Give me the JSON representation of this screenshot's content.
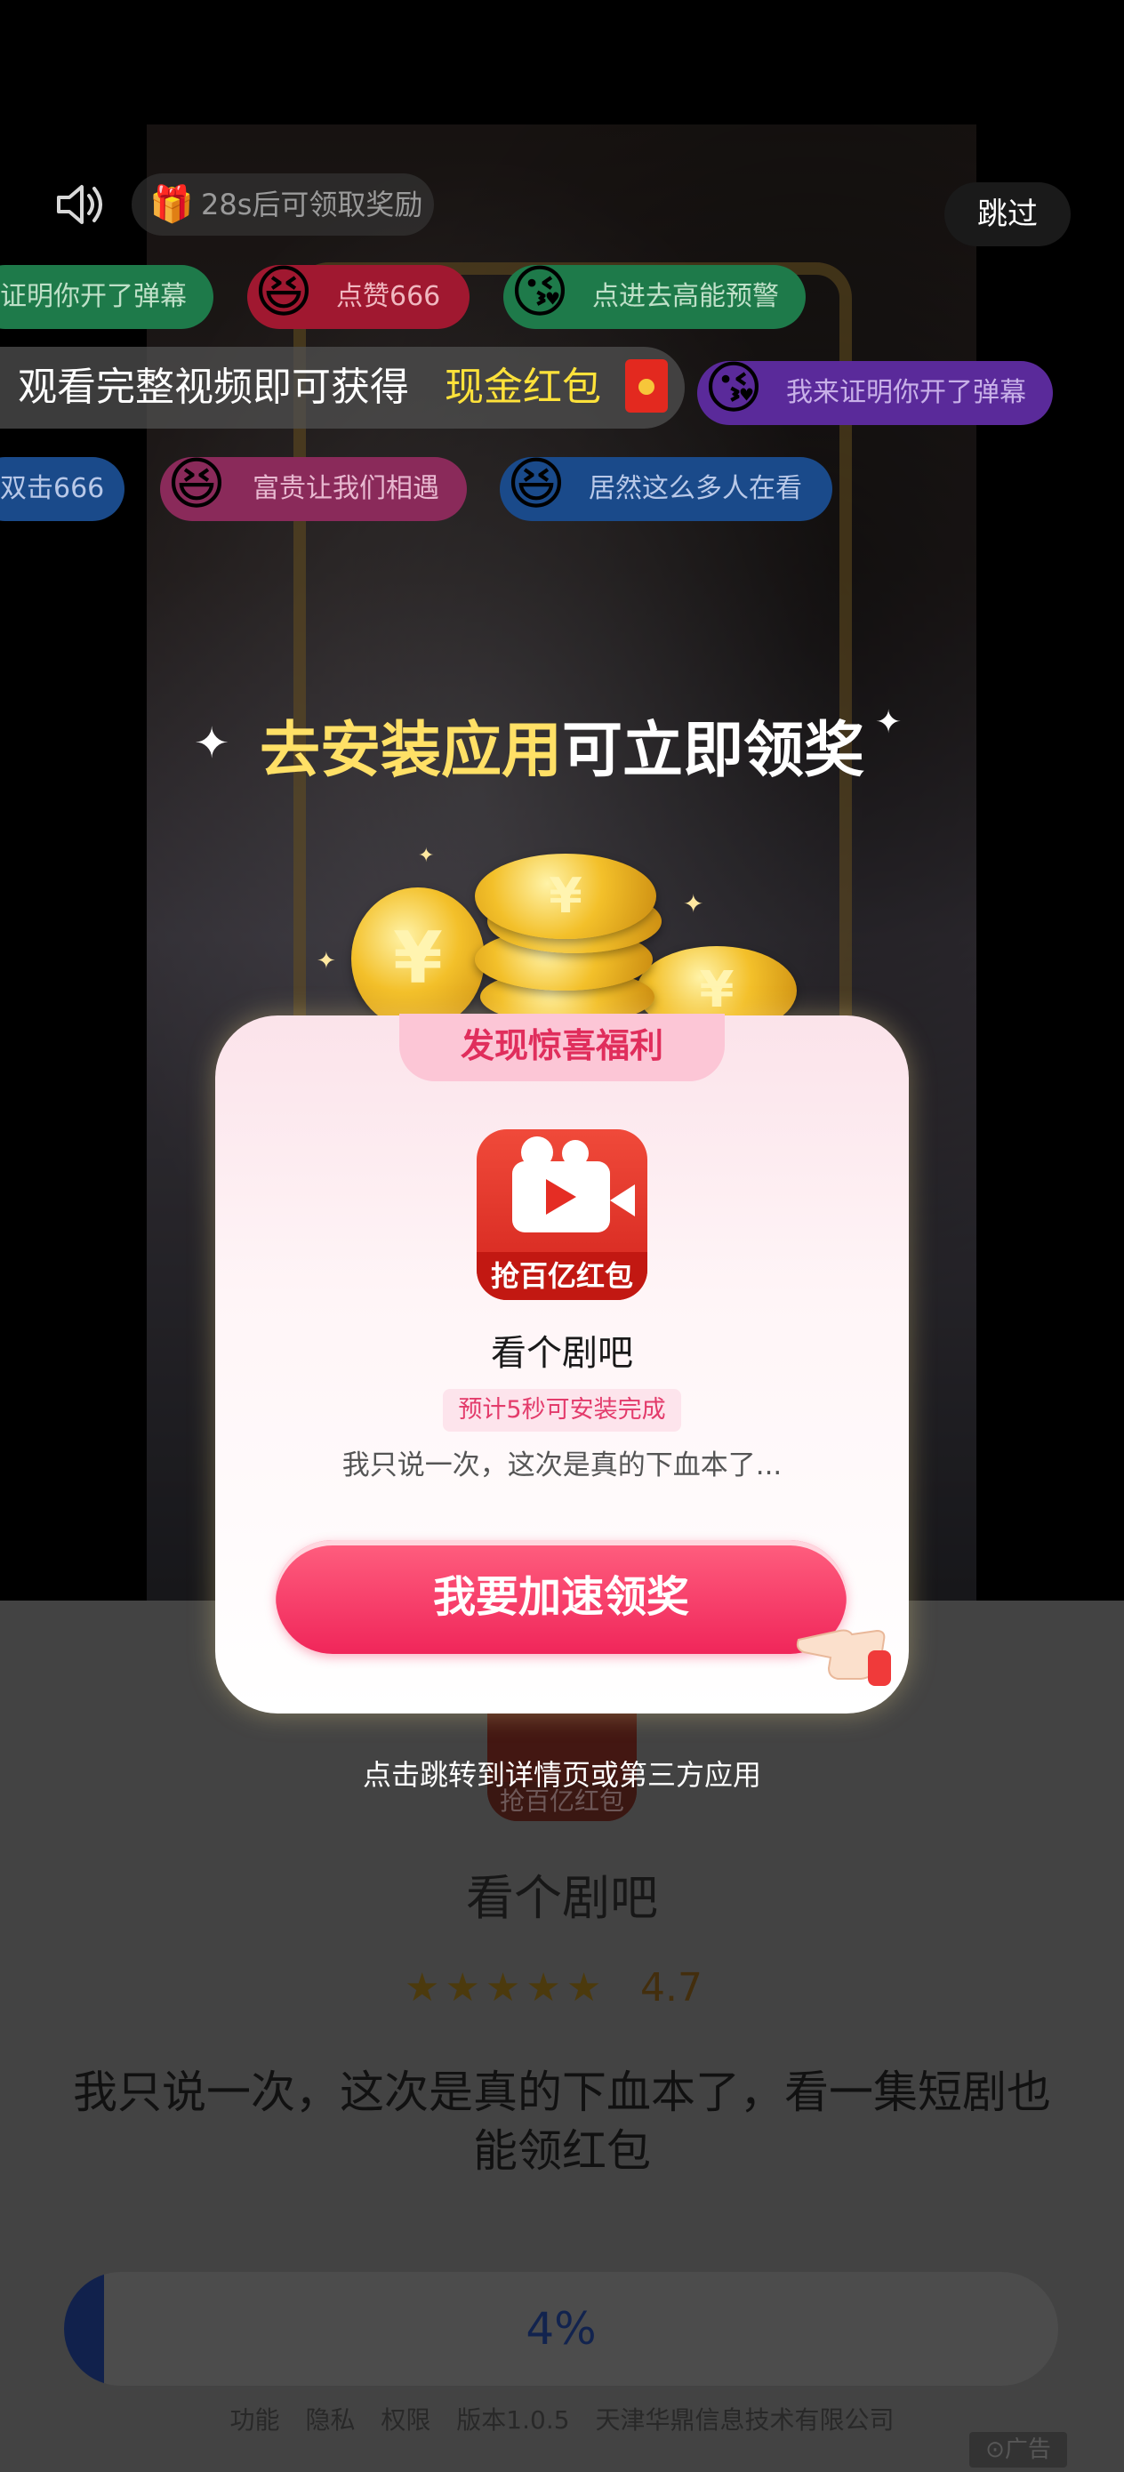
{
  "top_bar": {
    "sound_icon": "speaker-icon",
    "timer_text": "28s后可领取奖励",
    "skip_label": "跳过"
  },
  "danmaku": [
    {
      "text": "证明你开了弹幕",
      "color": "#1e7a4a"
    },
    {
      "text": "点赞666",
      "color": "#a01830"
    },
    {
      "text": "点进去高能预警",
      "color": "#1e7a4a"
    },
    {
      "text": "我来证明你开了弹幕",
      "color": "#5a2a9a"
    },
    {
      "text": "双击666",
      "color": "#1a4a8a"
    },
    {
      "text": "富贵让我们相遇",
      "color": "#8a2a5a"
    },
    {
      "text": "居然这么多人在看",
      "color": "#1a4a8a"
    }
  ],
  "banner": {
    "prefix": "观看完整视频即可获得",
    "highlight": "现金红包"
  },
  "headline": {
    "part1": "去安装应用",
    "part2": "可立即领奖"
  },
  "card": {
    "tab_label": "发现惊喜福利",
    "app_icon_label": "抢百亿红包",
    "app_name": "看个剧吧",
    "badge": "预计5秒可安装完成",
    "description": "我只说一次，这次是真的下血本了...",
    "cta_label": "我要加速领奖"
  },
  "redirect_note": "点击跳转到详情页或第三方应用",
  "bottom": {
    "app_name": "看个剧吧",
    "logo_label": "抢百亿红包",
    "rating": "4.7",
    "rating_value": 4.7,
    "description": "我只说一次，这次是真的下血本了，看一集短剧也能领红包",
    "progress_text": "4%",
    "progress_value": 0.04,
    "footer_links": [
      "功能",
      "隐私",
      "权限",
      "版本1.0.5",
      "天津华鼎信息技术有限公司"
    ],
    "ad_label": "广告"
  },
  "colors": {
    "cta_pink": "#f0265a",
    "highlight_yellow": "#ffe23a",
    "progress_blue": "#1f3c8a"
  }
}
